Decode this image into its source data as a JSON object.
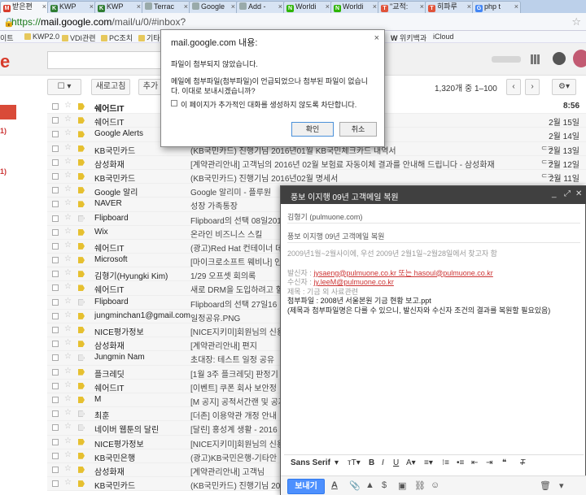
{
  "browser": {
    "tabs": [
      {
        "label": "받은편",
        "favicon": "gmail-icon",
        "color": "#d73b2b",
        "letter": "M",
        "active": true
      },
      {
        "label": "KWP",
        "favicon": "kwp-icon",
        "color": "#2f7d32",
        "letter": "K",
        "active": false
      },
      {
        "label": "KWP",
        "favicon": "kwp-icon",
        "color": "#2f7d32",
        "letter": "K",
        "active": false
      },
      {
        "label": "Terrac",
        "favicon": "page-icon",
        "color": "#9aa",
        "letter": "",
        "active": false
      },
      {
        "label": "Google",
        "favicon": "page-icon",
        "color": "#9aa",
        "letter": "",
        "active": false
      },
      {
        "label": "Add -",
        "favicon": "page-icon",
        "color": "#9aa",
        "letter": "",
        "active": false
      },
      {
        "label": "Worldi",
        "favicon": "naver-icon",
        "color": "#2db400",
        "letter": "N",
        "active": false
      },
      {
        "label": "Worldi",
        "favicon": "naver-icon",
        "color": "#2db400",
        "letter": "N",
        "active": false
      },
      {
        "label": "\"교적:",
        "favicon": "t-icon",
        "color": "#e0533a",
        "letter": "T",
        "active": false
      },
      {
        "label": "히파루",
        "favicon": "t-icon",
        "color": "#e0533a",
        "letter": "T",
        "active": false
      },
      {
        "label": "php t",
        "favicon": "google-icon",
        "color": "#4285f4",
        "letter": "G",
        "active": false
      }
    ],
    "url_secure": "https://",
    "url_host": "mail.google.com",
    "url_path": "/mail/u/0/#inbox?",
    "bookmarks": [
      "이트",
      "KWP2.0",
      "VDI관련",
      "PC조치",
      "기타",
      "위키백과",
      "iCloud"
    ]
  },
  "gmail": {
    "logo_fragment": "e",
    "toolbar": {
      "refresh_label": "새로고침",
      "more_label": "추가",
      "page_range": "1,320개 중 1–100",
      "prev_icon": "‹",
      "next_icon": "›"
    },
    "sidebar_counts": [
      "1)",
      "1)"
    ],
    "emails": [
      {
        "sender": "쉐어드IT",
        "subject": "",
        "date": "8:56",
        "unread": true,
        "important": true,
        "attachment": false
      },
      {
        "sender": "쉐어드IT",
        "subject": "",
        "date": "2월 15일",
        "unread": false,
        "important": true,
        "attachment": false
      },
      {
        "sender": "Google Alerts",
        "subject": "",
        "date": "2월 14일",
        "unread": false,
        "important": true,
        "attachment": false
      },
      {
        "sender": "KB국민카드",
        "subject": "(KB국민카드) 진행기님 2016년01월 KB국민체크카드 내역서",
        "date": "2월 13일",
        "unread": false,
        "important": true,
        "attachment": true
      },
      {
        "sender": "삼성화재",
        "subject": "[계약관리안내] 고객님의 2016년 02월 보험료 자동이체 결과를 안내해 드립니다 - 삼성화재",
        "date": "2월 12일",
        "unread": false,
        "important": true,
        "attachment": true
      },
      {
        "sender": "KB국민카드",
        "subject": "(KB국민카드) 진행기님 2016년02월 명세서",
        "date": "2월 11일",
        "unread": false,
        "important": true,
        "attachment": true
      },
      {
        "sender": "Google 알리",
        "subject": "Google 알리미 - 플루원",
        "date": "",
        "unread": false,
        "important": true,
        "attachment": false
      },
      {
        "sender": "NAVER",
        "subject": "성장 가족통장",
        "date": "",
        "unread": false,
        "important": true,
        "attachment": false
      },
      {
        "sender": "Flipboard",
        "subject": "Flipboard의 선택 08일2016",
        "date": "",
        "unread": false,
        "important": false,
        "attachment": false
      },
      {
        "sender": "Wix",
        "subject": "온라인 비즈니스 스킬",
        "date": "",
        "unread": false,
        "important": true,
        "attachment": false
      },
      {
        "sender": "쉐어드IT",
        "subject": "(광고)Red Hat 컨테이너 데",
        "date": "",
        "unread": false,
        "important": true,
        "attachment": false
      },
      {
        "sender": "Microsoft",
        "subject": "[마이크로소프트 웨비나] 인",
        "date": "",
        "unread": false,
        "important": true,
        "attachment": false
      },
      {
        "sender": "김형기(Hyungki Kim)",
        "subject": "1/29 오프셋 회의록",
        "date": "",
        "unread": false,
        "important": true,
        "attachment": false
      },
      {
        "sender": "쉐어드IT",
        "subject": "새로 DRM을 도입하려고 할",
        "date": "",
        "unread": false,
        "important": true,
        "attachment": false
      },
      {
        "sender": "Flipboard",
        "subject": "Flipboard의 선택 27일16",
        "date": "",
        "unread": false,
        "important": false,
        "attachment": false
      },
      {
        "sender": "jungminchan1@gmail.com (2)",
        "subject": "일정공유.PNG",
        "date": "",
        "unread": false,
        "important": true,
        "attachment": false
      },
      {
        "sender": "NICE평가정보",
        "subject": "[NICE지키미]회원님의 신용",
        "date": "",
        "unread": false,
        "important": true,
        "attachment": false
      },
      {
        "sender": "삼성화재",
        "subject": "[계약관리안내] 편지",
        "date": "",
        "unread": false,
        "important": true,
        "attachment": false
      },
      {
        "sender": "Jungmin Nam",
        "subject": "초대장: 테스트 일정 공유",
        "date": "",
        "unread": false,
        "important": false,
        "attachment": false
      },
      {
        "sender": "플크레딧",
        "subject": "[1월 3주 플크레딧] 판정기",
        "date": "",
        "unread": false,
        "important": true,
        "attachment": false
      },
      {
        "sender": "쉐어드IT",
        "subject": "[이벤트] 쿠폰 회사 보안정",
        "date": "",
        "unread": false,
        "important": true,
        "attachment": false
      },
      {
        "sender": "M",
        "subject": "[M 공지] 공적서간랜 및 공지",
        "date": "",
        "unread": false,
        "important": true,
        "attachment": false
      },
      {
        "sender": "최훈",
        "subject": "[더존] 이용약관 개정 안내",
        "date": "",
        "unread": false,
        "important": false,
        "attachment": false
      },
      {
        "sender": "네이버 웹툰의 달린",
        "subject": "[달린] 홍성계 생활 - 2016",
        "date": "",
        "unread": false,
        "important": false,
        "attachment": false
      },
      {
        "sender": "NICE평가정보",
        "subject": "[NICE지키미]회원님의 신용",
        "date": "",
        "unread": false,
        "important": true,
        "attachment": false
      },
      {
        "sender": "KB국민은행",
        "subject": "(광고)KB국민은행-기타안",
        "date": "",
        "unread": false,
        "important": true,
        "attachment": false
      },
      {
        "sender": "삼성화재",
        "subject": "[계약관리안내] 고객님",
        "date": "",
        "unread": false,
        "important": true,
        "attachment": false
      },
      {
        "sender": "KB국민카드",
        "subject": "(KB국민카드) 진행기님 20",
        "date": "",
        "unread": false,
        "important": true,
        "attachment": false
      }
    ]
  },
  "dialog": {
    "title": "mail.google.com 내용:",
    "message1": "파일이 첨부되지 않았습니다.",
    "message2": "메일에 첨부파일(첨부파일)이 언급되었으나 첨부된 파일이 없습니다. 이대로 보내시겠습니까?",
    "checkbox_label": "이 페이지가 추가적인 대화를 생성하지 않도록 차단합니다.",
    "ok_label": "확인",
    "cancel_label": "취소"
  },
  "compose": {
    "title": "풍보 이지행 09년 고객메일 복원",
    "to": "김형기 (pulmuone.com)",
    "subject": "풍보 이지행 09년 고객메일 복원",
    "body_line1": "2009년1월~2월사이에, 우선 2009년 2월1일~2월28일에서 찾고자 함",
    "body_line2_label": "발신자 :",
    "body_line2_value": "jysaeng@pulmuone.co.kr 또는 hasoul@pulmuone.co.kr",
    "body_line3_label": "수신자 :",
    "body_line3_value": "jy.leeM@pulmuone.co.kr",
    "body_line4": "제목 : 기금 외 사료관련",
    "body_line5": "첨부파일 : 2008년 서울본원 기금 현황 보고.ppt",
    "body_line6": "(제목과 첨부파일명은 다를 수 있으니, 발신자와 수신자 조건의 결과를 복원할 필요있음)",
    "font_label": "Sans Serif",
    "send_label": "보내기"
  }
}
